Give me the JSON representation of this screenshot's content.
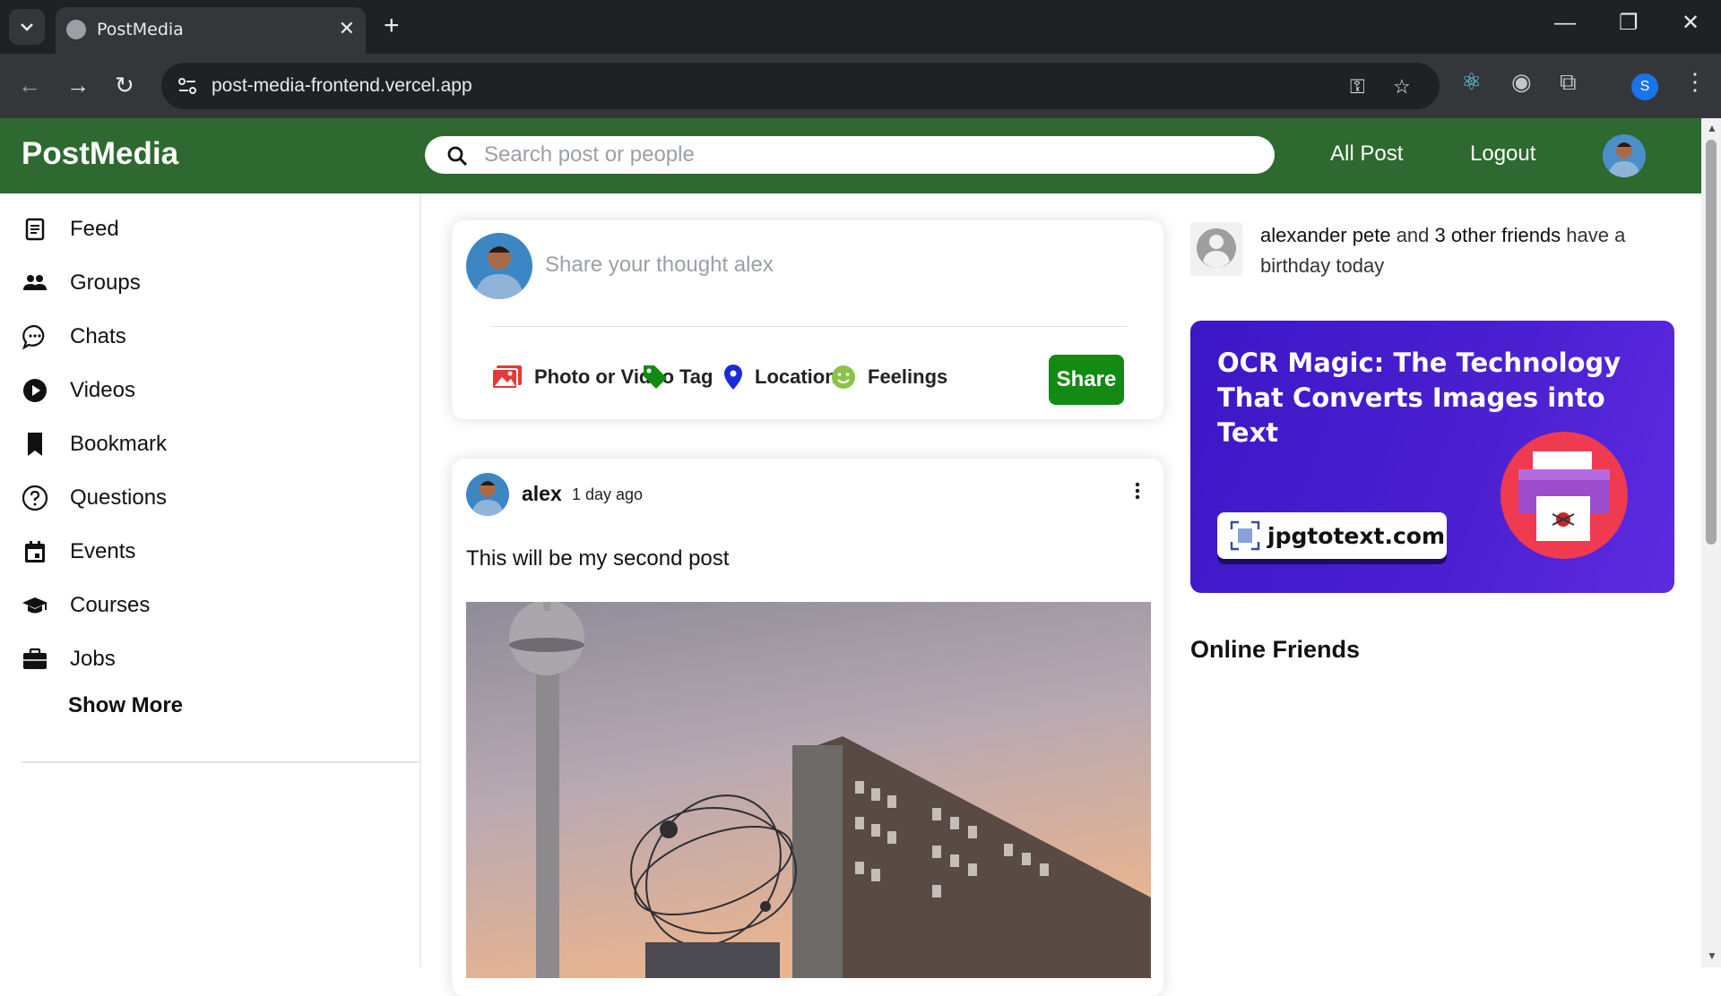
{
  "browser": {
    "tab_title": "PostMedia",
    "url": "post-media-frontend.vercel.app",
    "profile_initial": "S"
  },
  "app": {
    "logo": "PostMedia",
    "search_placeholder": "Search post or people",
    "nav": {
      "all_post": "All Post",
      "logout": "Logout"
    }
  },
  "sidebar": {
    "items": [
      {
        "label": "Feed",
        "icon": "feed-icon"
      },
      {
        "label": "Groups",
        "icon": "groups-icon"
      },
      {
        "label": "Chats",
        "icon": "chat-icon"
      },
      {
        "label": "Videos",
        "icon": "play-icon"
      },
      {
        "label": "Bookmark",
        "icon": "bookmark-icon"
      },
      {
        "label": "Questions",
        "icon": "question-icon"
      },
      {
        "label": "Events",
        "icon": "calendar-icon"
      },
      {
        "label": "Courses",
        "icon": "graduation-cap-icon"
      },
      {
        "label": "Jobs",
        "icon": "briefcase-icon"
      }
    ],
    "show_more": "Show More"
  },
  "share": {
    "placeholder": "Share your thought alex",
    "options": {
      "photo": "Photo or Video",
      "tag": "Tag",
      "location": "Location",
      "feelings": "Feelings"
    },
    "button": "Share",
    "colors": {
      "photo": "#e53935",
      "tag": "#138a13",
      "location": "#1a2bdb",
      "feelings": "#8bc34a",
      "share_button": "#138a13"
    }
  },
  "post": {
    "author": "alex",
    "time": "1 day ago",
    "text": "This will be my second post"
  },
  "birthday": {
    "name": "alexander pete",
    "joiner1": "and",
    "others": "3 other friends",
    "suffix": "have a birthday today"
  },
  "ad": {
    "title": "OCR Magic: The Technology That Converts Images into Text",
    "domain": "jpgtotext.com"
  },
  "online_friends_title": "Online Friends",
  "colors": {
    "header_green": "#2e6930",
    "ad_purple": "#4a1fd0"
  }
}
